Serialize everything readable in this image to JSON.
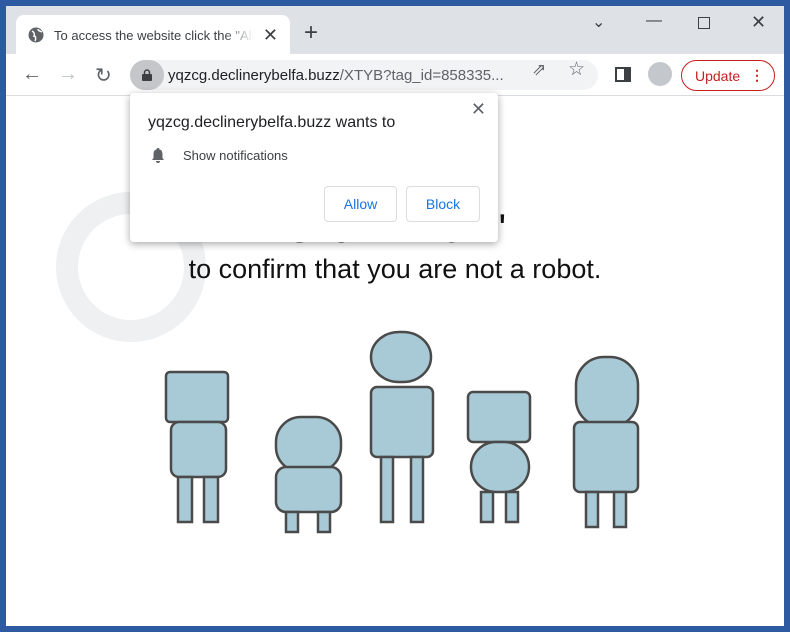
{
  "tab": {
    "title": "To access the website click the \"Allow\"",
    "icon": "globe-icon"
  },
  "address": {
    "domain": "yqzcg.declinerybelfa.buzz",
    "path": "/XTYB?tag_id=858335..."
  },
  "toolbar": {
    "update_label": "Update"
  },
  "page": {
    "heading": "Click \"Allow\"",
    "subheading": "to confirm that you are not a robot."
  },
  "popup": {
    "title": "yqzcg.declinerybelfa.buzz wants to",
    "permission": "Show notifications",
    "allow": "Allow",
    "block": "Block"
  },
  "colors": {
    "frame": "#2d5aa0",
    "update": "#c5221f",
    "link": "#1a73e8",
    "robot": "#a8cad6"
  }
}
